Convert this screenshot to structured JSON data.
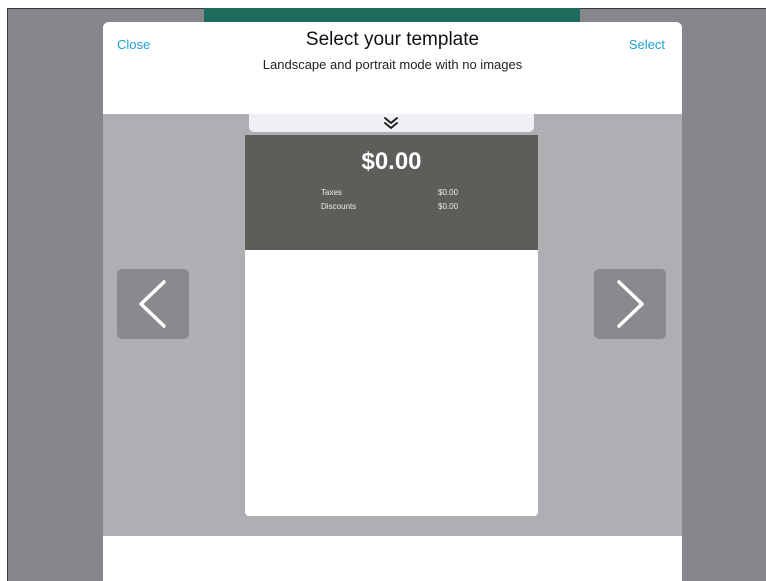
{
  "background": {
    "frame_color": "#86878b",
    "teal_color": "#1e6a5c",
    "teal_text": ""
  },
  "header": {
    "close_label": "Close",
    "title": "Select your template",
    "subtitle": "Landscape and portrait mode with no images",
    "select_label": "Select",
    "action_color": "#1d9fd6"
  },
  "preview": {
    "collapse_icon": "double-chevron-down-icon",
    "total": "$0.00",
    "rows": [
      {
        "label": "Taxes",
        "value": "$0.00"
      },
      {
        "label": "Discounts",
        "value": "$0.00"
      }
    ],
    "summary_color": "#5f5d59"
  },
  "nav": {
    "prev_icon": "chevron-left-icon",
    "next_icon": "chevron-right-icon"
  }
}
